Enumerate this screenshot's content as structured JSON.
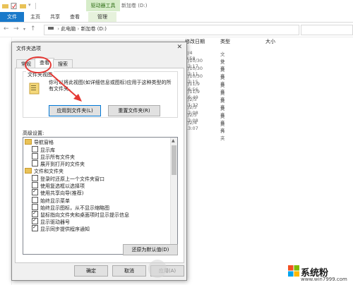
{
  "window": {
    "context_tab_group": "驱动器工具",
    "title": "新加卷 (D:)"
  },
  "ribbon": {
    "tabs": [
      "文件",
      "主页",
      "共享",
      "查看",
      "管理"
    ]
  },
  "address": {
    "crumbs": [
      "此电脑",
      "新加卷 (D:)"
    ]
  },
  "file_list": {
    "headers": {
      "date": "修改日期",
      "type": "类型",
      "size": "大小"
    },
    "rows": [
      {
        "date": "2/4 9:58",
        "type": "文件夹"
      },
      {
        "date": "7/10/30 12:17",
        "type": "文件夹"
      },
      {
        "date": "7/10/30 12:11",
        "type": "文件夹"
      },
      {
        "date": "7/10/30 12:15",
        "type": "文件夹"
      },
      {
        "date": "7/11/9 16:56",
        "type": "文件夹"
      },
      {
        "date": "7/11/9 16:49",
        "type": "文件夹"
      },
      {
        "date": "7/2/5 11:32",
        "type": "文件夹"
      },
      {
        "date": "7/2/5 12:08",
        "type": "文件夹"
      },
      {
        "date": "7/2/5 12:08",
        "type": "文件夹"
      },
      {
        "date": "7/2/4 13:07",
        "type": "文件夹"
      }
    ]
  },
  "dialog": {
    "title": "文件夹选项",
    "tabs": [
      "常规",
      "查看",
      "搜索"
    ],
    "active_tab": "查看",
    "view_group_label": "文件夹视图",
    "view_desc": "你可以将此视图(如详细信息或图标)应用于这种类型的所有文件夹。",
    "apply_to_folders": "应用到文件夹(L)",
    "reset_folders": "重置文件夹(R)",
    "advanced_label": "高级设置:",
    "advanced_items": [
      {
        "label": "导航窗格",
        "kind": "folder",
        "indent": 0
      },
      {
        "label": "显示库",
        "kind": "check",
        "checked": false,
        "indent": 1
      },
      {
        "label": "显示所有文件夹",
        "kind": "check",
        "checked": false,
        "indent": 1
      },
      {
        "label": "展开到打开的文件夹",
        "kind": "check",
        "checked": false,
        "indent": 1
      },
      {
        "label": "文件和文件夹",
        "kind": "folder",
        "indent": 0
      },
      {
        "label": "登录时还原上一个文件夹窗口",
        "kind": "check",
        "checked": false,
        "indent": 1
      },
      {
        "label": "使用复选框以选择项",
        "kind": "check",
        "checked": false,
        "indent": 1
      },
      {
        "label": "使用共享向导(推荐)",
        "kind": "check",
        "checked": true,
        "indent": 1
      },
      {
        "label": "始终显示菜单",
        "kind": "check",
        "checked": false,
        "indent": 1
      },
      {
        "label": "始终显示图标，从不显示缩略图",
        "kind": "check",
        "checked": false,
        "indent": 1
      },
      {
        "label": "鼠标指向文件夹和桌面项时显示提示信息",
        "kind": "check",
        "checked": true,
        "indent": 1
      },
      {
        "label": "显示驱动器号",
        "kind": "check",
        "checked": true,
        "indent": 1
      },
      {
        "label": "显示同步提供程序通知",
        "kind": "check",
        "checked": true,
        "indent": 1
      }
    ],
    "restore_defaults": "还原为默认值(D)",
    "ok": "确定",
    "cancel": "取消",
    "apply": "应用(A)"
  },
  "brand": {
    "name": "系统粉",
    "url": "www.win7999.com",
    "logo_colors": [
      "#f25022",
      "#7fba00",
      "#00a4ef",
      "#ffb900"
    ]
  },
  "annotation_color": "#e53935"
}
